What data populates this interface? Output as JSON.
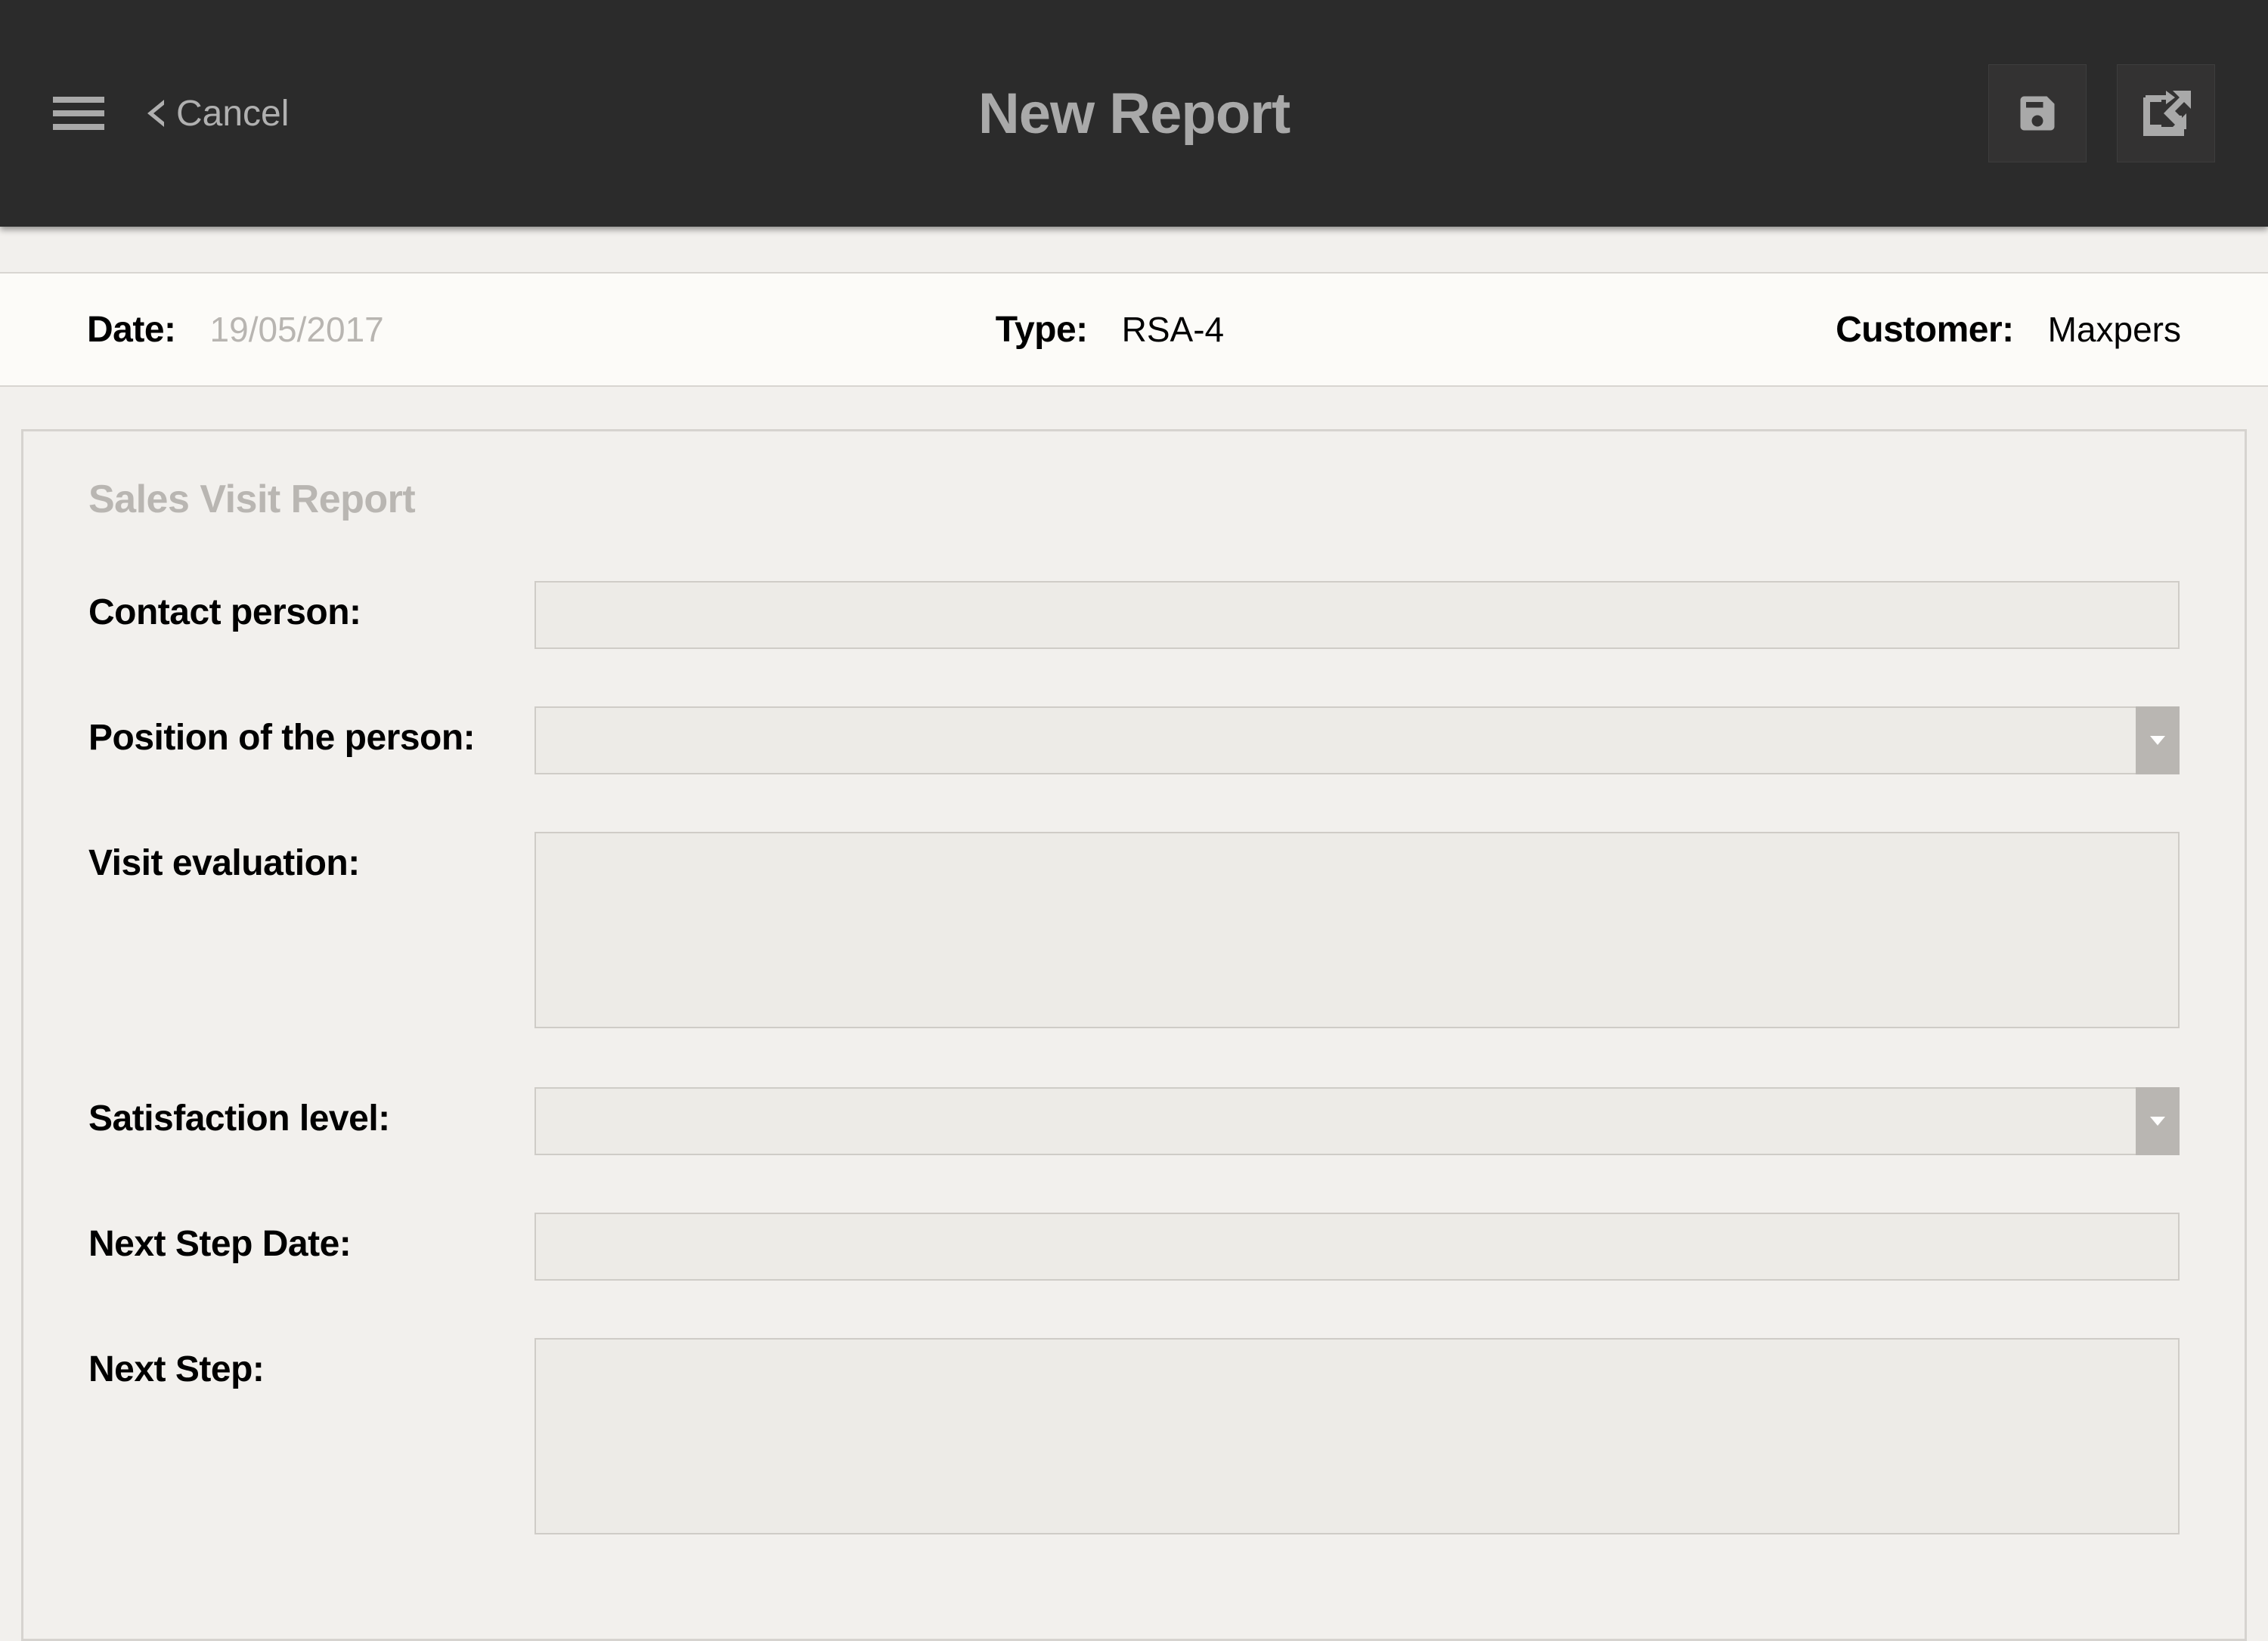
{
  "header": {
    "cancel_label": "Cancel",
    "title": "New Report"
  },
  "info": {
    "date_label": "Date:",
    "date_value": "19/05/2017",
    "type_label": "Type:",
    "type_value": "RSA-4",
    "customer_label": "Customer:",
    "customer_value": "Maxpers"
  },
  "form": {
    "section_title": "Sales Visit Report",
    "contact_person_label": "Contact person:",
    "contact_person_value": "",
    "position_label": "Position of the person:",
    "position_value": "",
    "visit_evaluation_label": "Visit evaluation:",
    "visit_evaluation_value": "",
    "satisfaction_label": "Satisfaction level:",
    "satisfaction_value": "",
    "next_step_date_label": "Next Step Date:",
    "next_step_date_value": "",
    "next_step_label": "Next Step:",
    "next_step_value": ""
  }
}
